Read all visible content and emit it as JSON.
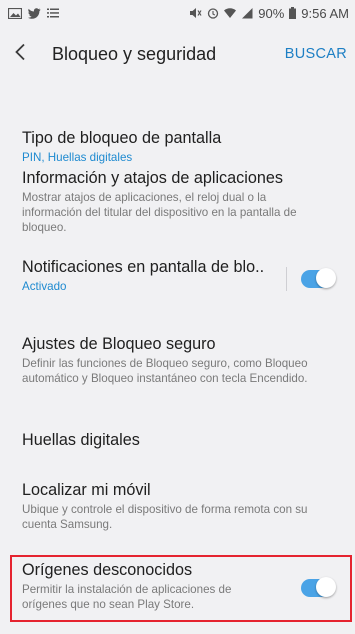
{
  "status_bar": {
    "battery": "90%",
    "time": "9:56 AM"
  },
  "app_bar": {
    "title": "Bloqueo y seguridad",
    "search_label": "BUSCAR"
  },
  "items": [
    {
      "title": "Tipo de bloqueo de pantalla",
      "subtitle": "PIN, Huellas digitales"
    },
    {
      "title": "Información y atajos de aplicaciones",
      "subtitle": "Mostrar atajos de aplicaciones, el reloj dual o la información del titular del dispositivo en la pantalla de bloqueo."
    },
    {
      "title": "Notificaciones en pantalla de blo..",
      "subtitle": "Activado",
      "toggle": true
    },
    {
      "title": "Ajustes de Bloqueo seguro",
      "subtitle": "Definir las funciones de Bloqueo seguro, como Bloqueo automático y Bloqueo instantáneo con tecla Encendido."
    },
    {
      "title": "Huellas digitales"
    },
    {
      "title": "Localizar mi móvil",
      "subtitle": "Ubique y controle el dispositivo de forma remota con su cuenta Samsung."
    },
    {
      "title": "Orígenes desconocidos",
      "subtitle": "Permitir la instalación de aplicaciones de orígenes que no sean Play Store.",
      "toggle": true
    }
  ],
  "colors": {
    "accent": "#1d7fc4",
    "toggle_on": "#4aa3e6",
    "highlight": "#e5232f"
  }
}
